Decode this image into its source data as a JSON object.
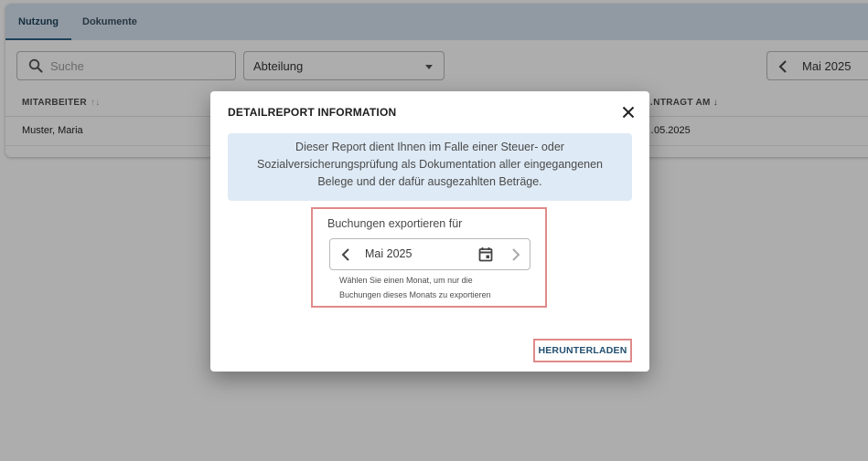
{
  "tabs": [
    {
      "label": "Nutzung",
      "active": true
    },
    {
      "label": "Dokumente",
      "active": false
    }
  ],
  "filters": {
    "search_placeholder": "Suche",
    "department_label": "Abteilung",
    "month_label": "Mai 2025"
  },
  "table": {
    "columns": [
      "MITARBEITER",
      "…NTRAGT AM"
    ],
    "rows": [
      {
        "employee": "Muster, Maria",
        "date": "…05.2025"
      }
    ]
  },
  "dialog": {
    "title": "DETAILREPORT INFORMATION",
    "info": "Dieser Report dient Ihnen im Falle einer Steuer- oder Sozialversicherungsprüfung als Dokumentation aller eingegangenen Belege und der dafür ausgezahlten Beträge.",
    "export_label": "Buchungen exportieren für",
    "month_value": "Mai 2025",
    "hint_line1": "Wählen Sie einen Monat, um nur die",
    "hint_line2": "Buchungen dieses Monats zu exportieren",
    "download_label": "HERUNTERLADEN"
  },
  "colors": {
    "accent": "#234f70",
    "tabbar": "#d6e4f0",
    "info_bg": "#deeaf5",
    "highlight": "#e08a8a"
  },
  "icons": [
    "search-icon",
    "chevron-down-icon",
    "chevron-left-icon",
    "sort-icon",
    "arrow-down-icon",
    "close-icon",
    "calendar-icon",
    "chevron-right-icon"
  ]
}
